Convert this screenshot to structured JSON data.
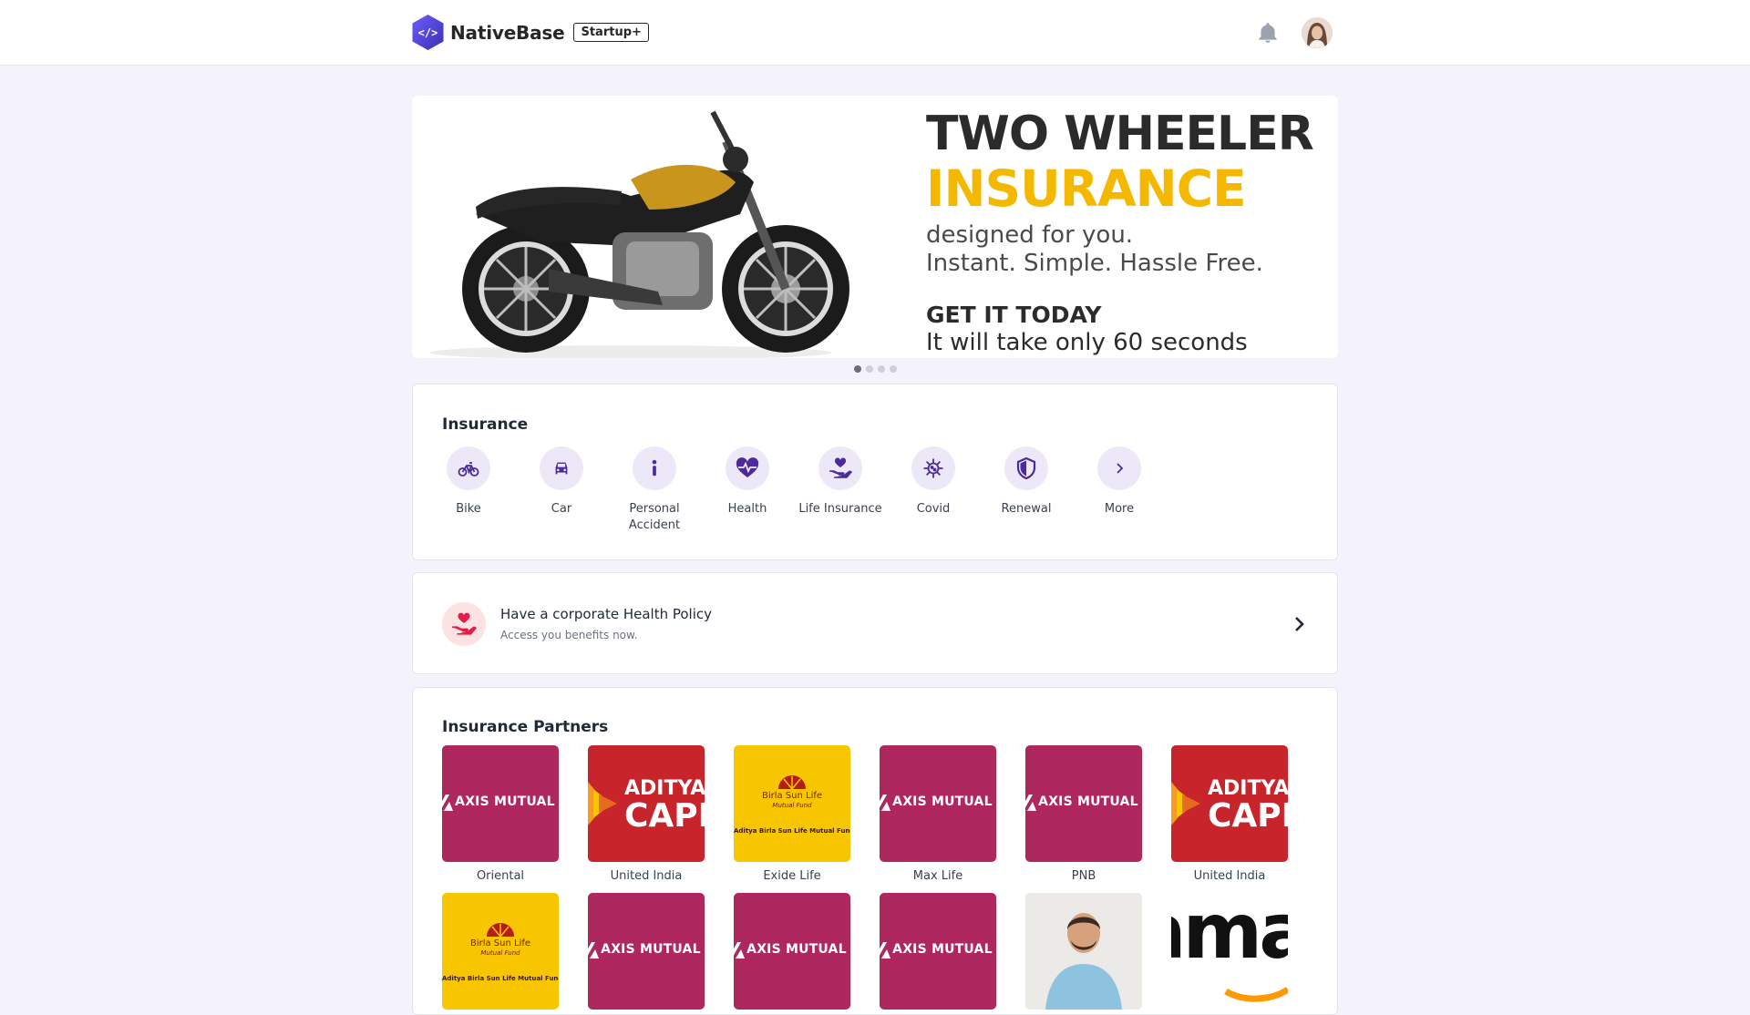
{
  "header": {
    "brand": "NativeBase",
    "plan_badge": "Startup+",
    "icons": {
      "notifications": "bell-icon",
      "avatar": "user-avatar"
    }
  },
  "banner": {
    "line1": "TWO WHEELER",
    "line2": "INSURANCE",
    "line3": "designed for you.",
    "line4": "Instant. Simple. Hassle Free.",
    "line5": "GET IT TODAY",
    "line6": "It will take only 60 seconds",
    "slide_count": 4,
    "active_slide": 1,
    "colors": {
      "accent": "#f5b800",
      "dark": "#2b2b2b"
    }
  },
  "insurance": {
    "title": "Insurance",
    "items": [
      {
        "label": "Bike",
        "icon": "bicycle-icon"
      },
      {
        "label": "Car",
        "icon": "car-icon"
      },
      {
        "label": "Personal Accident",
        "icon": "person-icon"
      },
      {
        "label": "Health",
        "icon": "heart-pulse-icon"
      },
      {
        "label": "Life Insurance",
        "icon": "hand-heart-icon"
      },
      {
        "label": "Covid",
        "icon": "virus-icon"
      },
      {
        "label": "Renewal",
        "icon": "shield-icon"
      },
      {
        "label": "More",
        "icon": "chevron-right-icon"
      }
    ]
  },
  "corporate": {
    "title": "Have a corporate Health Policy",
    "subtitle": "Access you benefits now."
  },
  "partners": {
    "title": "Insurance Partners",
    "row1": [
      {
        "name": "Oriental",
        "logo": "axis"
      },
      {
        "name": "United India",
        "logo": "aditya"
      },
      {
        "name": "Exide Life",
        "logo": "birla"
      },
      {
        "name": "Max Life",
        "logo": "axis"
      },
      {
        "name": "PNB",
        "logo": "axis"
      },
      {
        "name": "United India",
        "logo": "aditya"
      }
    ],
    "logo_text": {
      "axis": "AXIS MUTUAL FUND",
      "aditya_top": "ADITYA BIRLA",
      "aditya_bottom": "CAPITAL",
      "birla_top": "Birla Sun Life",
      "birla_mid": "Mutual Fund",
      "birla_bottom": "Aditya Birla Sun Life Mutual Fund",
      "amazon": "amazon"
    },
    "colors": {
      "axis": "#ae275f",
      "aditya": "#c8242b",
      "birla": "#f7c600"
    }
  }
}
